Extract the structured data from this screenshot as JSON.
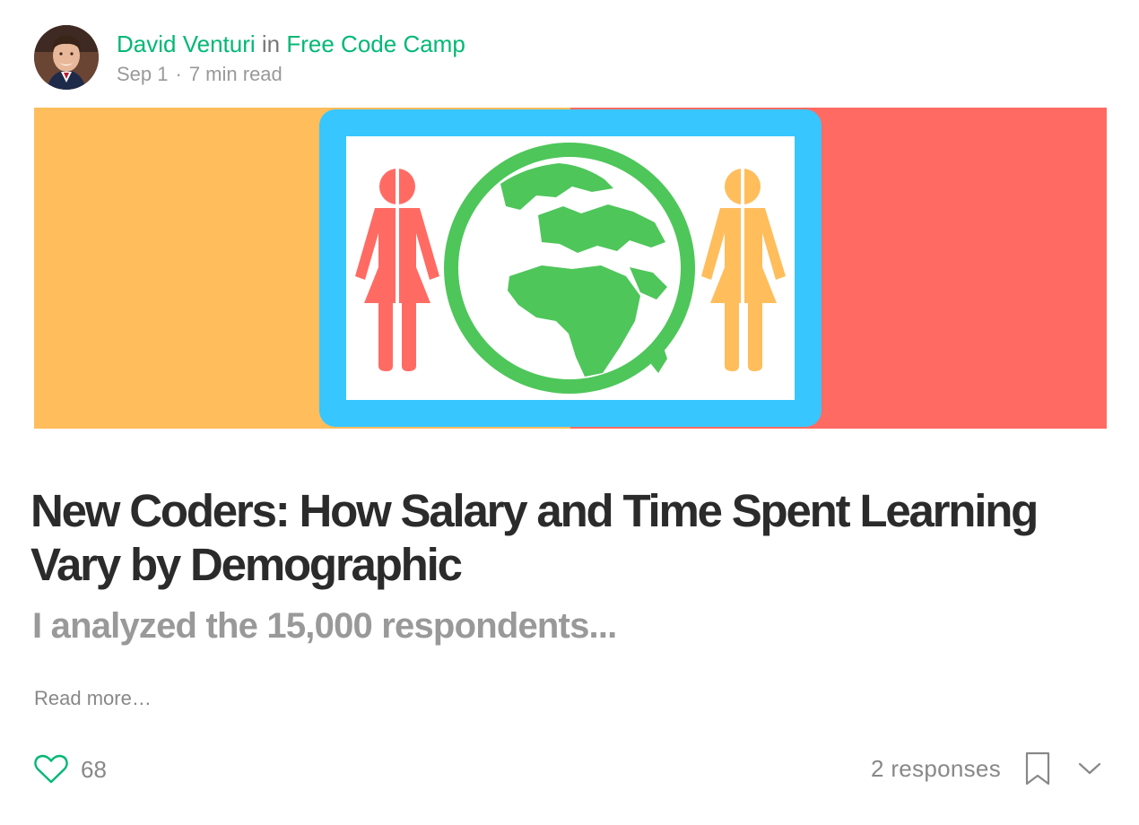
{
  "post": {
    "author": "David Venturi",
    "in_text": "in",
    "publication": "Free Code Camp",
    "date": "Sep 1",
    "separator": "·",
    "read_time": "7 min read",
    "title": "New Coders: How Salary and Time Spent Learning Vary by Demographic",
    "subtitle": "I analyzed the 15,000 respondents...",
    "read_more": "Read more…"
  },
  "footer": {
    "likes": "68",
    "responses": "2 responses"
  },
  "colors": {
    "brand_green": "#02b875",
    "hero_left": "#ffbd5c",
    "hero_right": "#ff6b63",
    "hero_frame": "#38c6ff",
    "globe": "#4ec65a",
    "figure_red": "#ff6b63",
    "figure_orange": "#ffbd5c"
  },
  "icons": {
    "heart": "heart-icon",
    "bookmark": "bookmark-icon",
    "chevron": "chevron-down-icon"
  }
}
